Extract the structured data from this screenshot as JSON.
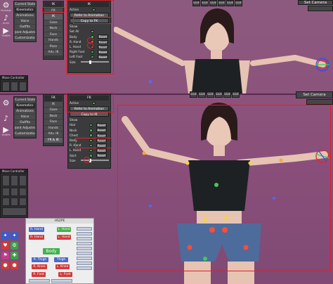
{
  "state_panel": {
    "items": [
      "Current State",
      "Kinematics",
      "Animations",
      "Voice",
      "Outfits",
      "Joint Adjustment",
      "Customization"
    ],
    "selected": "Kinematics"
  },
  "top_view": {
    "tabs": [
      "IK",
      "FK",
      "IK",
      "Gaze",
      "Neck",
      "Face",
      "Hands",
      "Pose",
      "Adv. IK"
    ],
    "panel_header": "IK",
    "active_label": "Active",
    "refer_label": "Refer to Animation",
    "copy_label": "Copy to FK",
    "show_label": "Show",
    "rows": [
      {
        "label": "Set All",
        "reset": ""
      },
      {
        "label": "Body",
        "reset": "Reset"
      },
      {
        "label": "R. Hand",
        "reset": "Reset"
      },
      {
        "label": "L. Hand",
        "reset": "Reset"
      },
      {
        "label": "Right Foot",
        "reset": "Reset"
      },
      {
        "label": "Left Foot",
        "reset": "Reset"
      }
    ],
    "size_label": "Size"
  },
  "bottom_view": {
    "tabs": [
      "FK",
      "IK",
      "Gaze",
      "Neck",
      "Face",
      "Hands",
      "Adv. IK",
      "FK & IK"
    ],
    "panel_header": "FK",
    "active_label": "Active",
    "refer_label": "Refer to Animation",
    "copy_label": "Copy to IK",
    "show_label": "Show",
    "rows": [
      {
        "label": "Hair",
        "reset": "Reset"
      },
      {
        "label": "Neck",
        "reset": "Reset"
      },
      {
        "label": "Chest",
        "reset": "Reset"
      },
      {
        "label": "Body",
        "reset": "Reset"
      },
      {
        "label": "R. Hand",
        "reset": "Reset"
      },
      {
        "label": "L. Hand",
        "reset": "Reset"
      },
      {
        "label": "Skirt",
        "reset": "Reset"
      }
    ],
    "size_label": "Size"
  },
  "move_controller": {
    "title": "Move Controller"
  },
  "sidebar_icons": [
    {
      "name": "kinematics-icon",
      "glyph": "⚙",
      "cap": "Kinemat"
    },
    {
      "name": "music-icon",
      "glyph": "♪",
      "cap": "Anim"
    },
    {
      "name": "play-icon",
      "glyph": "▶",
      "cap": "ShiftPe"
    }
  ],
  "bottom_icons": [
    {
      "name": "settings-icon",
      "glyph": "⚙",
      "cap": ""
    },
    {
      "name": "music-icon",
      "glyph": "♪",
      "cap": ""
    },
    {
      "name": "play-icon",
      "glyph": "▶",
      "cap": "ShiftPe"
    }
  ],
  "save_buttons": {
    "label": "SAVE",
    "count": 6
  },
  "set_camera": "Set Camera",
  "hs2pe": {
    "title": "HS2PE",
    "body": "Body",
    "left_labels": [
      "R. Hand",
      "R. Hand",
      "R. Thigh",
      "R. Knee",
      "R. Foot"
    ],
    "right_labels": [
      "L. Hand",
      "L. Hand",
      "Thigh",
      "L. Knee",
      "L. Foot"
    ]
  },
  "colors": {
    "bg": "#8a4f79",
    "panel": "#3b3b3e",
    "highlight": "#e0202a",
    "check": "#49b84c",
    "hs2pe_green": "#42b24a",
    "hs2pe_red": "#d23a3a",
    "hs2pe_blue": "#4a6ac8"
  }
}
